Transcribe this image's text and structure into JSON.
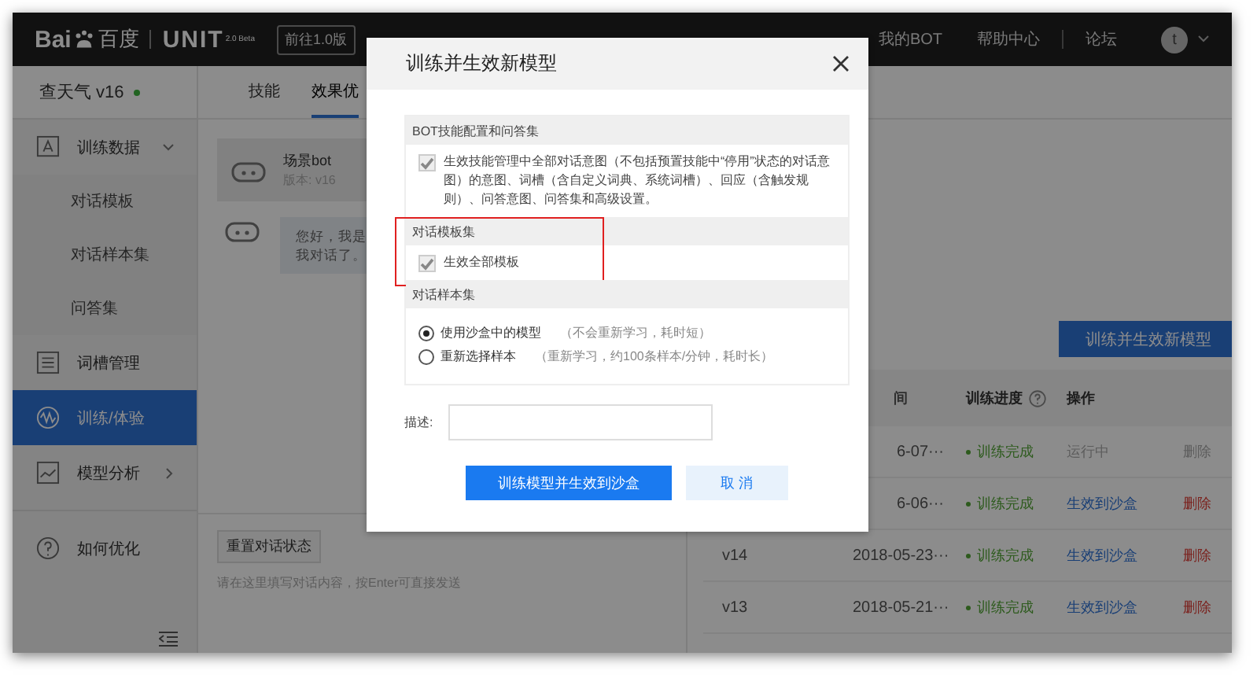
{
  "header": {
    "logo_text": "Bai",
    "logo_cn": "百度",
    "product": "UNIT",
    "product_sup": "2.0 Beta",
    "switch_button": "前往1.0版",
    "nav": [
      "我的BOT",
      "帮助中心",
      "论坛"
    ],
    "avatar": "t"
  },
  "bot": {
    "name": "查天气 v16",
    "online": true
  },
  "tabs": [
    {
      "label": "技能",
      "selected": false
    },
    {
      "label": "效果优",
      "selected": true
    }
  ],
  "sidebar": {
    "items": [
      {
        "label": "训练数据",
        "selected": false,
        "expanded": true,
        "children": [
          {
            "label": "对话模板"
          },
          {
            "label": "对话样本集"
          },
          {
            "label": "问答集"
          }
        ]
      },
      {
        "label": "词槽管理",
        "selected": false
      },
      {
        "label": "训练/体验",
        "selected": true
      },
      {
        "label": "模型分析",
        "selected": false,
        "expanded": false
      },
      {
        "label": "如何优化",
        "selected": false
      }
    ]
  },
  "chat": {
    "bot_name": "场景bot",
    "bot_version": "版本: v16",
    "messages": [
      {
        "lines": [
          "您好，我是",
          "我对话了。"
        ]
      }
    ],
    "reset_button": "重置对话状态",
    "placeholder": "请在这里填写对话内容，按Enter可直接发送"
  },
  "models": {
    "train_button": "训练并生效新模型",
    "columns": [
      "间",
      "训练进度",
      "操作"
    ],
    "rows": [
      {
        "version": "",
        "date": "6-07···",
        "status": "训练完成",
        "action": "运行中",
        "action_disabled": true,
        "delete": "删除",
        "delete_disabled": true
      },
      {
        "version": "",
        "date": "6-06···",
        "status": "训练完成",
        "action": "生效到沙盒",
        "action_disabled": false,
        "delete": "删除",
        "delete_disabled": false
      },
      {
        "version": "v14",
        "date": "2018-05-23···",
        "status": "训练完成",
        "action": "生效到沙盒",
        "action_disabled": false,
        "delete": "删除",
        "delete_disabled": false
      },
      {
        "version": "v13",
        "date": "2018-05-21···",
        "status": "训练完成",
        "action": "生效到沙盒",
        "action_disabled": false,
        "delete": "删除",
        "delete_disabled": false
      }
    ]
  },
  "dialog": {
    "title": "训练并生效新模型",
    "sections": [
      {
        "kind": "checkbox",
        "heading": "BOT技能配置和问答集",
        "options": [
          {
            "label": "生效技能管理中全部对话意图（不包括预置技能中“停用”状态的对话意图）的意图、词槽（含自定义词典、系统词槽）、回应（含触发规则）、问答意图、问答集和高级设置。",
            "checked": true,
            "disabled": true
          }
        ]
      },
      {
        "kind": "checkbox",
        "heading": "对话模板集",
        "highlighted": true,
        "options": [
          {
            "label": "生效全部模板",
            "checked": true,
            "disabled": true
          }
        ]
      },
      {
        "kind": "radio",
        "heading": "对话样本集",
        "options": [
          {
            "label": "使用沙盒中的模型",
            "hint": "（不会重新学习，耗时短）",
            "selected": true
          },
          {
            "label": "重新选择样本",
            "hint": "（重新学习，约100条样本/分钟，耗时长）",
            "selected": false
          }
        ]
      }
    ],
    "description_label": "描述:",
    "confirm_button": "训练模型并生效到沙盒",
    "cancel_button": "取 消"
  }
}
